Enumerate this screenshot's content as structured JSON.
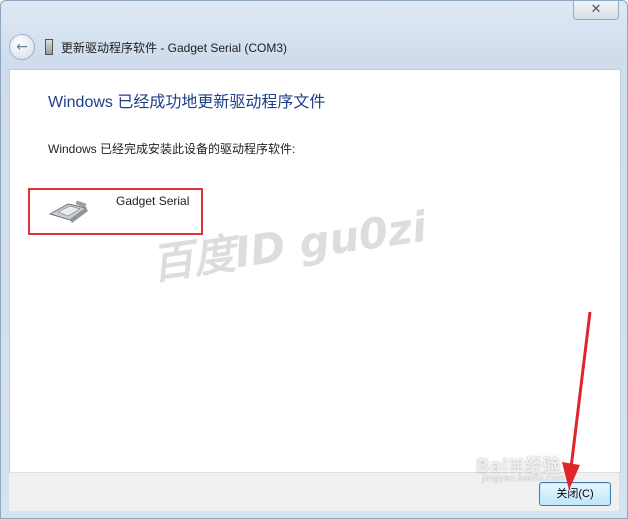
{
  "window": {
    "close_glyph": "✕",
    "header_title": "更新驱动程序软件 - Gadget Serial (COM3)"
  },
  "content": {
    "main_heading": "Windows 已经成功地更新驱动程序文件",
    "description": "Windows 已经完成安装此设备的驱动程序软件:",
    "device_name": "Gadget Serial"
  },
  "footer": {
    "close_button_label": "关闭(C)"
  },
  "watermarks": {
    "main": "百度ID gu0zi",
    "logo": "Bai⌘经验",
    "url": "jingyan.baidu.com"
  },
  "colors": {
    "heading": "#1d3f8a",
    "highlight": "#d9353a",
    "annotation_arrow": "#e0262b"
  }
}
